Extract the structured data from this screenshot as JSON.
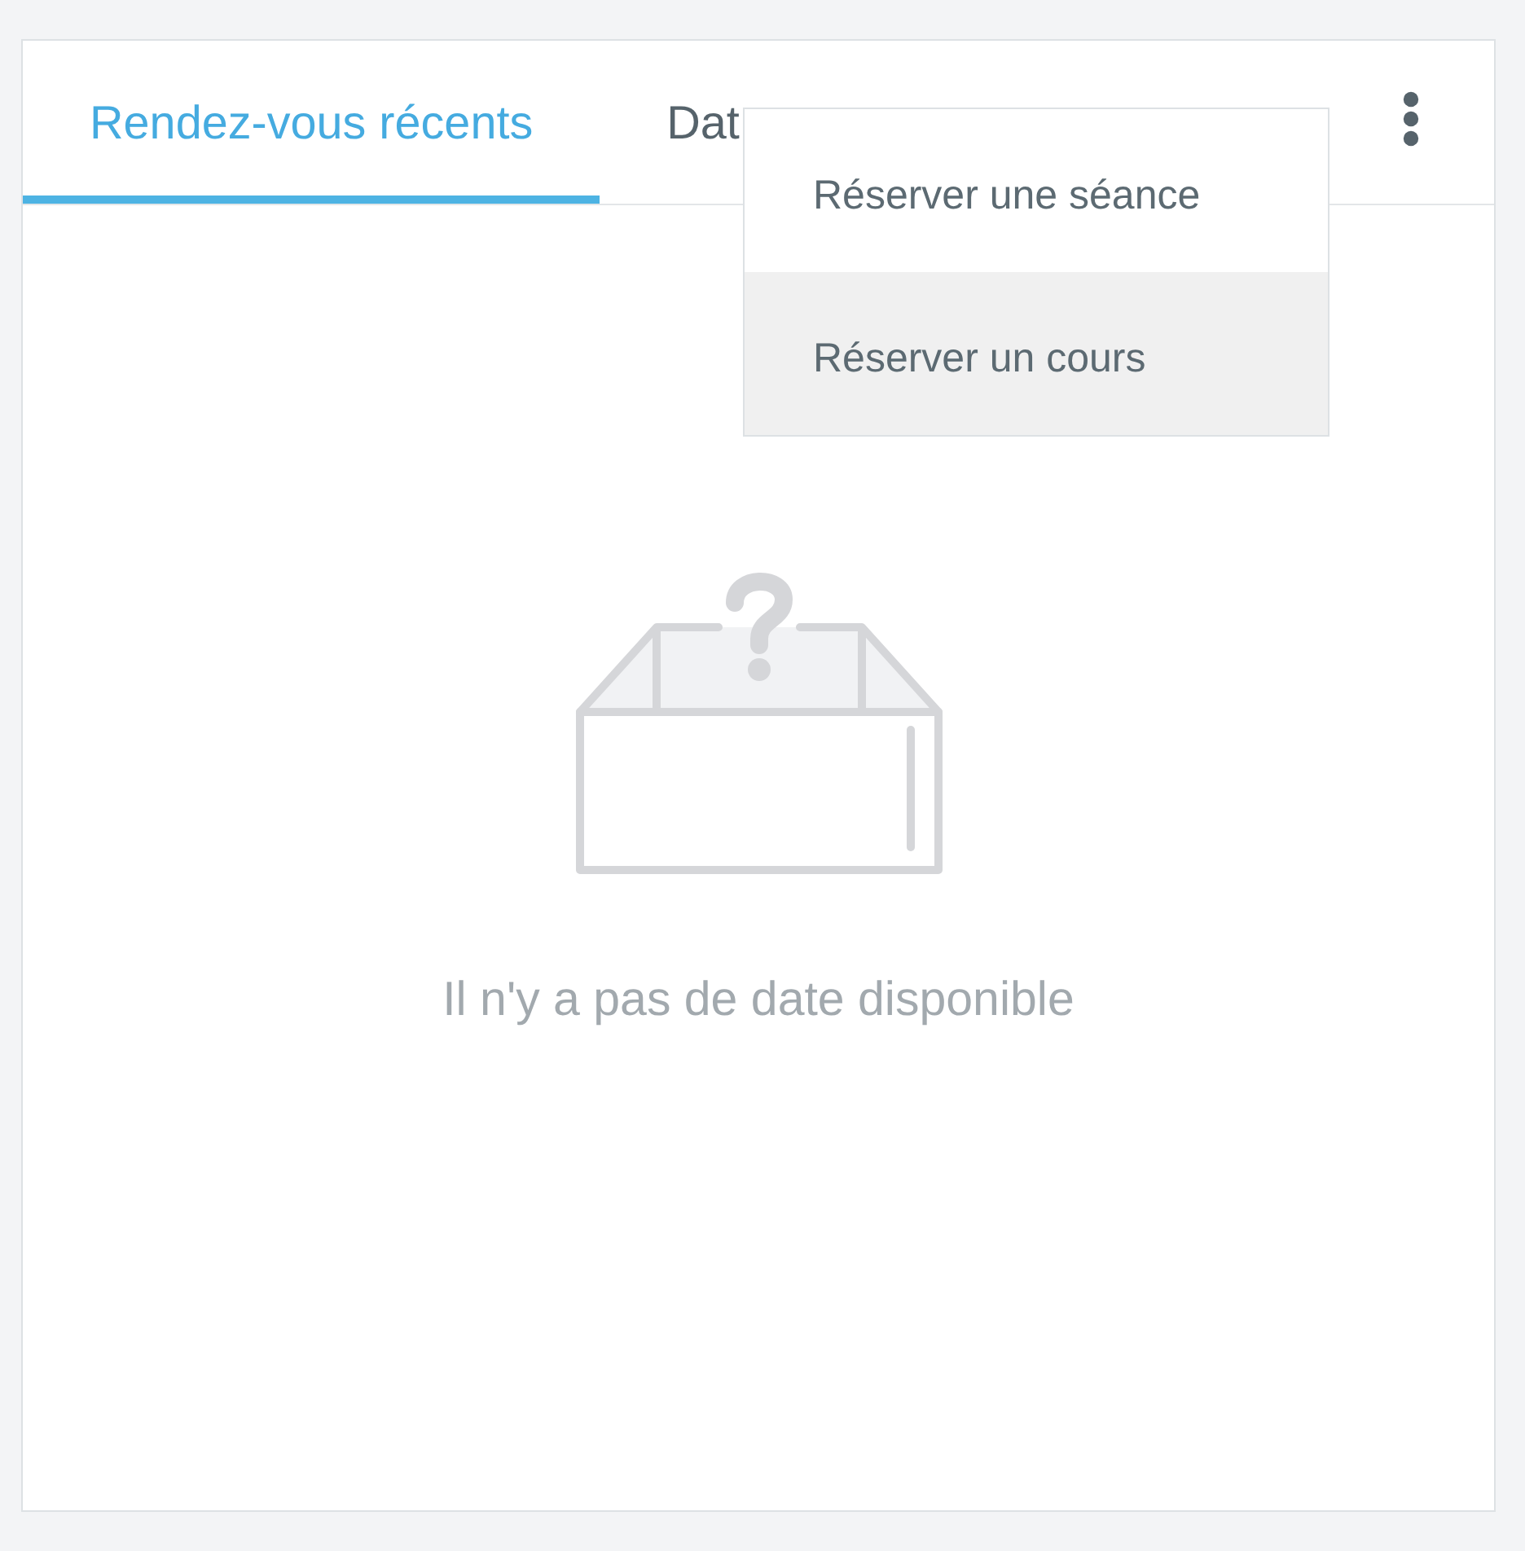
{
  "tabs": [
    {
      "label": "Rendez-vous récents",
      "selected": true
    },
    {
      "label": "Dat",
      "selected": false
    }
  ],
  "menu": {
    "open": true,
    "items": [
      {
        "label": "Réserver une séance",
        "selected": false
      },
      {
        "label": "Réserver un cours",
        "selected": true
      }
    ]
  },
  "empty_state": {
    "message": "Il n'y a pas de date disponible"
  }
}
